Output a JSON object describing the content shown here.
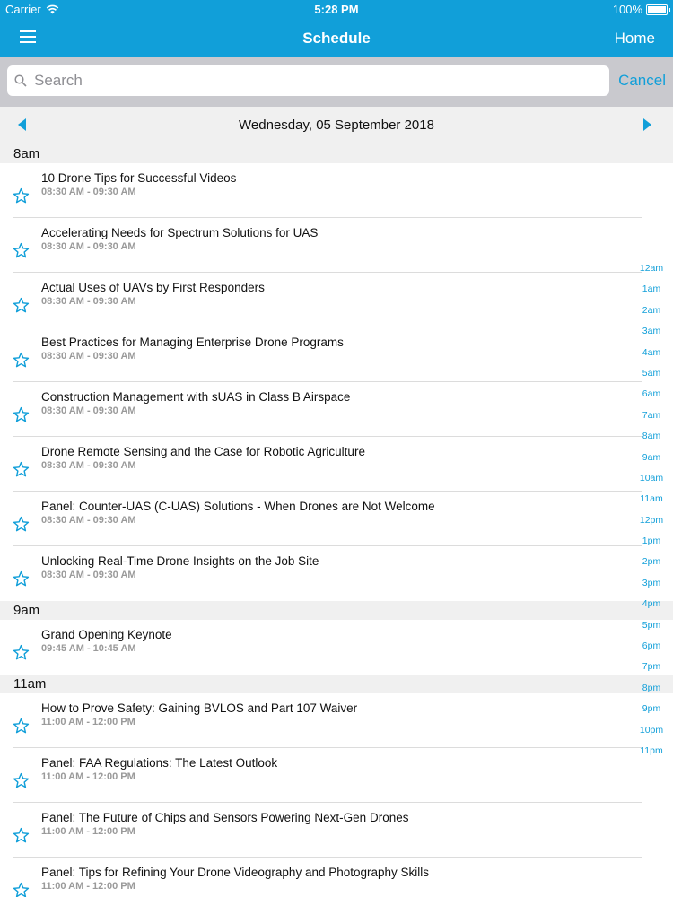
{
  "status": {
    "carrier": "Carrier",
    "time": "5:28 PM",
    "battery": "100%"
  },
  "nav": {
    "title": "Schedule",
    "home_label": "Home"
  },
  "search": {
    "placeholder": "Search",
    "cancel_label": "Cancel"
  },
  "date_label": "Wednesday, 05 September 2018",
  "sections": [
    {
      "hour": "8am",
      "sessions": [
        {
          "title": "10 Drone Tips for Successful Videos",
          "time": "08:30 AM - 09:30 AM"
        },
        {
          "title": "Accelerating Needs for Spectrum Solutions for UAS",
          "time": "08:30 AM - 09:30 AM"
        },
        {
          "title": "Actual Uses of UAVs by First Responders",
          "time": "08:30 AM - 09:30 AM"
        },
        {
          "title": "Best Practices for Managing Enterprise Drone Programs",
          "time": "08:30 AM - 09:30 AM"
        },
        {
          "title": "Construction Management with sUAS in Class B Airspace",
          "time": "08:30 AM - 09:30 AM"
        },
        {
          "title": "Drone Remote Sensing and the Case for Robotic Agriculture",
          "time": "08:30 AM - 09:30 AM"
        },
        {
          "title": "Panel: Counter-UAS (C-UAS) Solutions - When Drones are Not Welcome",
          "time": "08:30 AM - 09:30 AM"
        },
        {
          "title": "Unlocking Real-Time Drone Insights on the Job Site",
          "time": "08:30 AM - 09:30 AM"
        }
      ]
    },
    {
      "hour": "9am",
      "sessions": [
        {
          "title": "Grand Opening Keynote",
          "time": "09:45 AM - 10:45 AM"
        }
      ]
    },
    {
      "hour": "11am",
      "sessions": [
        {
          "title": "How to Prove Safety: Gaining BVLOS and Part 107 Waiver",
          "time": "11:00 AM - 12:00 PM"
        },
        {
          "title": "Panel: FAA Regulations: The Latest Outlook",
          "time": "11:00 AM - 12:00 PM"
        },
        {
          "title": "Panel: The Future of Chips and Sensors Powering Next-Gen Drones",
          "time": "11:00 AM - 12:00 PM"
        },
        {
          "title": "Panel: Tips for Refining Your Drone Videography and Photography Skills",
          "time": "11:00 AM - 12:00 PM"
        }
      ]
    }
  ],
  "hour_index": [
    "12am",
    "1am",
    "2am",
    "3am",
    "4am",
    "5am",
    "6am",
    "7am",
    "8am",
    "9am",
    "10am",
    "11am",
    "12pm",
    "1pm",
    "2pm",
    "3pm",
    "4pm",
    "5pm",
    "6pm",
    "7pm",
    "8pm",
    "9pm",
    "10pm",
    "11pm"
  ],
  "colors": {
    "accent": "#119fd9",
    "section_bg": "#f0f0f0",
    "search_bg": "#c9c9ce"
  }
}
